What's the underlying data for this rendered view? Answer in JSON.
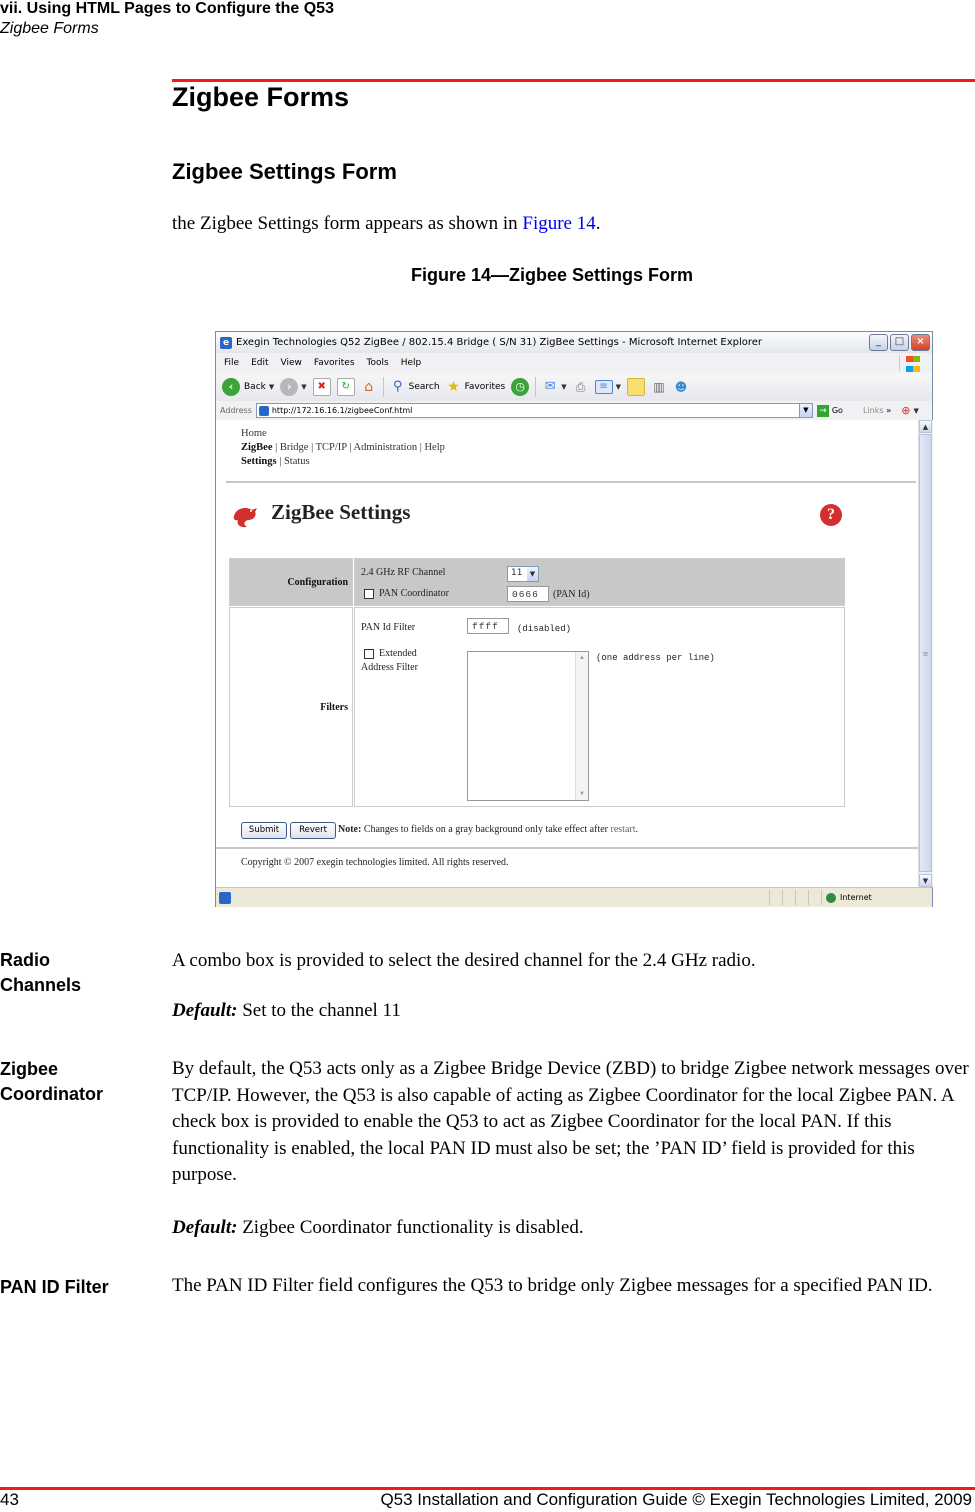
{
  "header": {
    "chapter": "vii. Using HTML Pages to Configure the Q53",
    "section": "Zigbee Forms"
  },
  "heading1": "Zigbee Forms",
  "heading2": "Zigbee Settings Form",
  "intro": {
    "text_before": "the Zigbee Settings form appears as shown in ",
    "link": "Figure 14",
    "text_after": "."
  },
  "figure_caption": "Figure 14—Zigbee Settings Form",
  "browser": {
    "title": "Exegin Technologies Q52 ZigBee / 802.15.4 Bridge ( S/N 31) ZigBee Settings - Microsoft Internet Explorer",
    "menu": [
      "File",
      "Edit",
      "View",
      "Favorites",
      "Tools",
      "Help"
    ],
    "toolbar": {
      "back": "Back",
      "search": "Search",
      "favorites": "Favorites"
    },
    "address_label": "Address",
    "url": "http://172.16.16.1/zigbeeConf.html",
    "go": "Go",
    "links": "Links",
    "status_zone": "Internet",
    "page": {
      "nav": {
        "home": "Home",
        "level1": [
          "ZigBee",
          "Bridge",
          "TCP/IP",
          "Administration",
          "Help"
        ],
        "level2": [
          "Settings",
          "Status"
        ]
      },
      "title": "ZigBee Settings",
      "help_icon": "?",
      "configuration": {
        "label": "Configuration",
        "rf_channel_label": "2.4 GHz RF Channel",
        "rf_channel_value": "11",
        "pan_coordinator_label": "PAN Coordinator",
        "pan_coordinator_checked": false,
        "pan_id_value": "0666",
        "pan_id_label": "(PAN Id)"
      },
      "filters": {
        "label": "Filters",
        "pan_id_filter_label": "PAN Id Filter",
        "pan_id_filter_value": "ffff",
        "pan_id_filter_hint": "(disabled)",
        "extended_label": "Extended",
        "address_filter_label": "Address Filter",
        "extended_checked": false,
        "address_hint": "(one address per line)",
        "address_value": ""
      },
      "submit": "Submit",
      "revert": "Revert",
      "note_label": "Note:",
      "note_text": " Changes to fields on a gray background only take effect after ",
      "note_link": "restart",
      "note_end": ".",
      "copyright": "Copyright © 2007 exegin technologies limited. All rights reserved."
    }
  },
  "sections": [
    {
      "term_line1": "Radio",
      "term_line2": "Channels",
      "body": "A combo box is provided to select the desired channel for the 2.4 GHz radio.",
      "default_label": "Default:",
      "default_text": " Set to the channel 11"
    },
    {
      "term_line1": "Zigbee",
      "term_line2": "Coordinator",
      "body": "By default, the Q53 acts only as a Zigbee Bridge Device (ZBD) to bridge Zigbee network messages over TCP/IP. However, the Q53 is also capable of acting as Zigbee Coordinator for the local Zigbee PAN. A check box is provided to enable the Q53 to act as Zigbee Coordinator for the local PAN. If this functionality is enabled, the local PAN ID must also be set; the ’PAN ID’ field is provided for this purpose.",
      "default_label": "Default:",
      "default_text": " Zigbee Coordinator functionality is disabled."
    },
    {
      "term_line1": "PAN ID Filter",
      "body": "The PAN ID Filter field configures the Q53 to bridge only Zigbee messages for a specified PAN ID."
    }
  ],
  "footer": {
    "page_number": "43",
    "doc_title": "Q53 Installation and Configuration Guide  © Exegin Technologies Limited, 2009"
  },
  "colors": {
    "rule_red": "#ee1c1c",
    "link_blue": "#0000ee",
    "config_gray": "#c8c8c8",
    "help_red": "#d32f2f"
  }
}
